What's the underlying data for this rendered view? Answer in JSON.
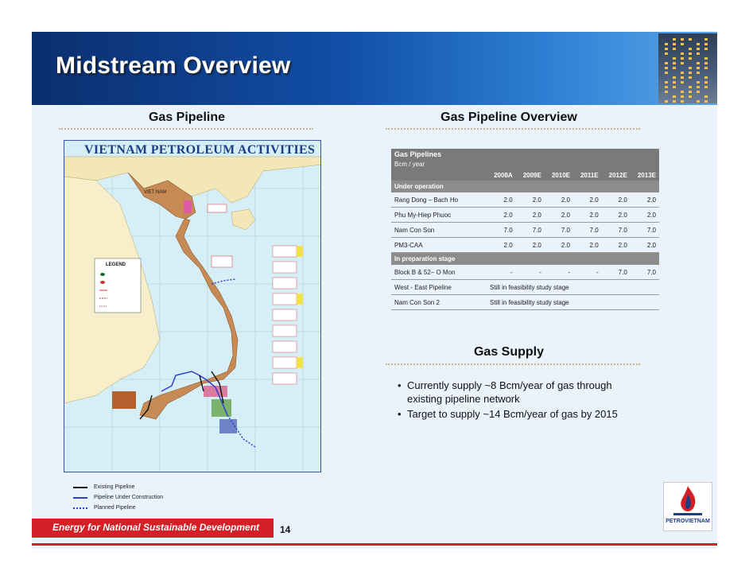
{
  "slide": {
    "title": "Midstream Overview",
    "page_number": "14",
    "footer_tagline": "Energy for National Sustainable Development",
    "logo_text": "PETROVIETNAM"
  },
  "left_section": {
    "heading": "Gas Pipeline",
    "map_title": "VIETNAM PETROLEUM ACTIVITIES",
    "map_country_label": "VIET NAM",
    "map_legend_title": "LEGEND",
    "legend": [
      {
        "label": "Existing Pipeline",
        "color": "#111111",
        "style": "solid"
      },
      {
        "label": "Pipeline Under Construction",
        "color": "#2d3fd1",
        "style": "solid"
      },
      {
        "label": "Planned Pipeline",
        "color": "#2d3fd1",
        "style": "dotted"
      }
    ]
  },
  "table_section": {
    "heading": "Gas Pipeline Overview",
    "title": "Gas Pipelines",
    "unit": "Bcm / year",
    "columns": [
      "2008A",
      "2009E",
      "2010E",
      "2011E",
      "2012E",
      "2013E"
    ],
    "groups": [
      {
        "name": "Under operation",
        "rows": [
          {
            "name": "Rang Dong – Bach Ho",
            "values": [
              "2.0",
              "2.0",
              "2.0",
              "2.0",
              "2.0",
              "2.0"
            ]
          },
          {
            "name": "Phu My-Hiep Phuoc",
            "values": [
              "2.0",
              "2.0",
              "2.0",
              "2.0",
              "2.0",
              "2.0"
            ]
          },
          {
            "name": "Nam Con Son",
            "values": [
              "7.0",
              "7.0",
              "7.0",
              "7.0",
              "7.0",
              "7.0"
            ]
          },
          {
            "name": "PM3-CAA",
            "values": [
              "2.0",
              "2.0",
              "2.0",
              "2.0",
              "2.0",
              "2.0"
            ]
          }
        ]
      },
      {
        "name": "In preparation stage",
        "rows": [
          {
            "name": "Block B & 52– O Mon",
            "values": [
              "-",
              "-",
              "-",
              "-",
              "7.0",
              "7.0"
            ]
          },
          {
            "name": "West - East Pipeline",
            "note": "Still in feasibility study stage"
          },
          {
            "name": "Nam Con Son 2",
            "note": "Still in feasibility study stage"
          }
        ]
      }
    ]
  },
  "supply_section": {
    "heading": "Gas Supply",
    "bullets": [
      "Currently supply ~8 Bcm/year of gas through existing pipeline network",
      "Target to supply ~14 Bcm/year of gas by 2015"
    ]
  },
  "colors": {
    "banner_dark": "#0b2e6e",
    "banner_light": "#5aa5e8",
    "accent_red": "#d41f26",
    "table_header": "#7a7a7a"
  }
}
